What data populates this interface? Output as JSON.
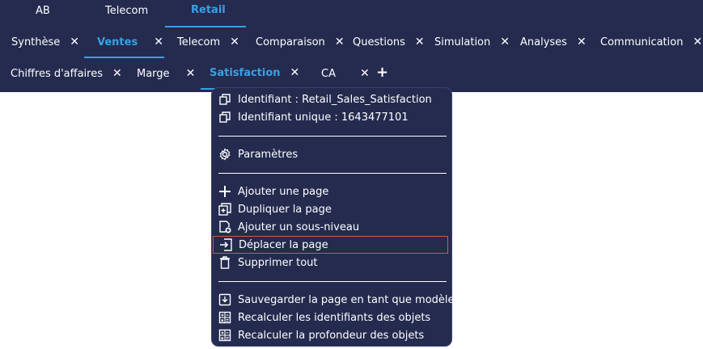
{
  "top_tabs": [
    {
      "label": "AB"
    },
    {
      "label": "Telecom"
    },
    {
      "label": "Retail"
    }
  ],
  "second_tabs": [
    {
      "label": "Synthèse",
      "close": "✕"
    },
    {
      "label": "Ventes",
      "close": "✕"
    },
    {
      "label": "Telecom",
      "close": "✕"
    },
    {
      "label": "Comparaison",
      "close": "✕"
    },
    {
      "label": "Questions",
      "close": "✕"
    },
    {
      "label": "Simulation",
      "close": "✕"
    },
    {
      "label": "Analyses",
      "close": "✕"
    },
    {
      "label": "Communication",
      "close": "✕"
    }
  ],
  "third_tabs": [
    {
      "label": "Chiffres d'affaires",
      "close": "✕"
    },
    {
      "label": "Marge",
      "close": "✕"
    },
    {
      "label": "Satisfaction",
      "close": "✕"
    },
    {
      "label": "CA",
      "close": "✕"
    }
  ],
  "add_tab": "+",
  "context_menu": {
    "items": [
      {
        "label": "Identifiant : Retail_Sales_Satisfaction",
        "icon": "copy-icon"
      },
      {
        "label": "Identifiant unique : 1643477101",
        "icon": "copy-icon"
      },
      {
        "label": "Paramètres",
        "icon": "gear-icon"
      },
      {
        "label": "Ajouter une page",
        "icon": "plus-icon"
      },
      {
        "label": "Dupliquer la page",
        "icon": "duplicate-icon"
      },
      {
        "label": "Ajouter un sous-niveau",
        "icon": "add-sublevel-icon"
      },
      {
        "label": "Déplacer la page",
        "icon": "move-icon"
      },
      {
        "label": "Supprimer tout",
        "icon": "trash-icon"
      },
      {
        "label": "Sauvegarder la page en tant que modèle",
        "icon": "save-template-icon"
      },
      {
        "label": "Recalculer les identifiants des objets",
        "icon": "calculator-icon"
      },
      {
        "label": "Recalculer la profondeur des objets",
        "icon": "calculator-icon"
      }
    ]
  },
  "colors": {
    "navbar_bg": "#242b4f",
    "accent": "#39a0e6",
    "highlight_border": "#d9534f"
  }
}
